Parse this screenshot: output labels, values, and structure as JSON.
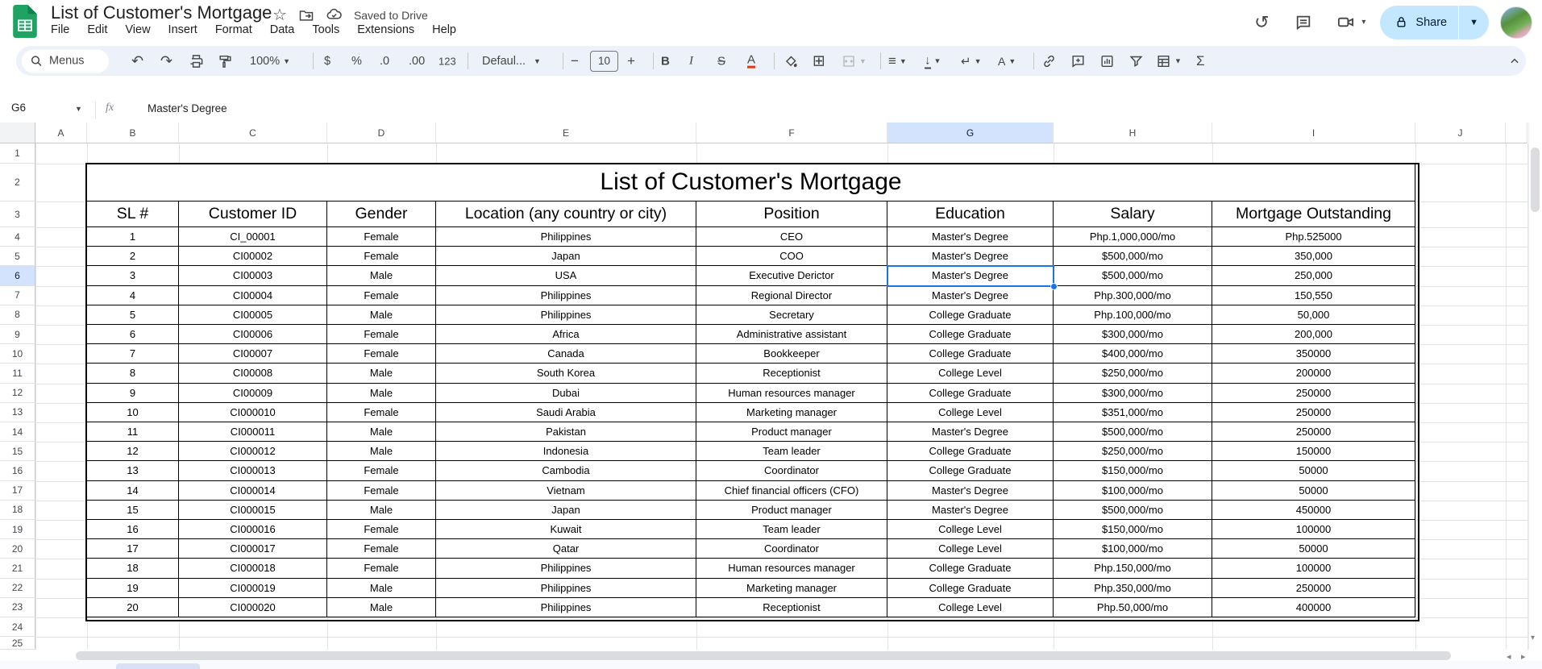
{
  "app": {
    "product": "Google Sheets",
    "title": "List of Customer's Mortgage",
    "saved_status": "Saved to Drive",
    "menus": [
      "File",
      "Edit",
      "View",
      "Insert",
      "Format",
      "Data",
      "Tools",
      "Extensions",
      "Help"
    ],
    "share_label": "Share"
  },
  "toolbar": {
    "menus_label": "Menus",
    "zoom_value": "100%",
    "currency": "$",
    "percent": "%",
    "decimal_decrease": ".0",
    "decimal_increase": ".00",
    "number_format": "123",
    "font_name": "Defaul...",
    "decrease_font": "−",
    "font_size": "10",
    "increase_font": "+",
    "bold": "B",
    "italic": "I",
    "strikethrough": "S",
    "text_color": "A",
    "text_rotation": "A",
    "sum": "Σ"
  },
  "formula_bar": {
    "cell_ref": "G6",
    "fx_label": "fx",
    "value": "Master's Degree"
  },
  "grid": {
    "columns": [
      "A",
      "B",
      "C",
      "D",
      "E",
      "F",
      "G",
      "H",
      "I",
      "J"
    ],
    "visible_rows": 25,
    "selected_cell": {
      "column": "G",
      "row": 6
    }
  },
  "sheet": {
    "table_title": "List of Customer's Mortgage",
    "headers": [
      "SL #",
      "Customer ID",
      "Gender",
      "Location (any country or city)",
      "Position",
      "Education",
      "Salary",
      "Mortgage Outstanding"
    ],
    "rows": [
      [
        "1",
        "CI_00001",
        "Female",
        "Philippines",
        "CEO",
        "Master's Degree",
        "Php.1,000,000/mo",
        "Php.525000"
      ],
      [
        "2",
        "CI00002",
        "Female",
        "Japan",
        "COO",
        "Master's Degree",
        "$500,000/mo",
        "350,000"
      ],
      [
        "3",
        "CI00003",
        "Male",
        "USA",
        "Executive Derictor",
        "Master's Degree",
        "$500,000/mo",
        "250,000"
      ],
      [
        "4",
        "CI00004",
        "Female",
        "Philippines",
        "Regional Director",
        "Master's Degree",
        "Php.300,000/mo",
        "150,550"
      ],
      [
        "5",
        "CI00005",
        "Male",
        "Philippines",
        "Secretary",
        "College Graduate",
        "Php.100,000/mo",
        "50,000"
      ],
      [
        "6",
        "CI00006",
        "Female",
        "Africa",
        "Administrative assistant",
        "College Graduate",
        "$300,000/mo",
        "200,000"
      ],
      [
        "7",
        "CI00007",
        "Female",
        "Canada",
        "Bookkeeper",
        "College Graduate",
        "$400,000/mo",
        "350000"
      ],
      [
        "8",
        "CI00008",
        "Male",
        "South Korea",
        "Receptionist",
        "College Level",
        "$250,000/mo",
        "200000"
      ],
      [
        "9",
        "CI00009",
        "Male",
        "Dubai",
        "Human resources manager",
        "College Graduate",
        "$300,000/mo",
        "250000"
      ],
      [
        "10",
        "CI000010",
        "Female",
        "Saudi Arabia",
        "Marketing manager",
        "College Level",
        "$351,000/mo",
        "250000"
      ],
      [
        "11",
        "CI000011",
        "Male",
        "Pakistan",
        "Product manager",
        "Master's Degree",
        "$500,000/mo",
        "250000"
      ],
      [
        "12",
        "CI000012",
        "Male",
        "Indonesia",
        "Team leader",
        "College Graduate",
        "$250,000/mo",
        "150000"
      ],
      [
        "13",
        "CI000013",
        "Female",
        "Cambodia",
        "Coordinator",
        "College Graduate",
        "$150,000/mo",
        "50000"
      ],
      [
        "14",
        "CI000014",
        "Female",
        "Vietnam",
        "Chief financial officers (CFO)",
        "Master's Degree",
        "$100,000/mo",
        "50000"
      ],
      [
        "15",
        "CI000015",
        "Male",
        "Japan",
        "Product manager",
        "Master's Degree",
        "$500,000/mo",
        "450000"
      ],
      [
        "16",
        "CI000016",
        "Female",
        "Kuwait",
        "Team leader",
        "College Level",
        "$150,000/mo",
        "100000"
      ],
      [
        "17",
        "CI000017",
        "Female",
        "Qatar",
        "Coordinator",
        "College Level",
        "$100,000/mo",
        "50000"
      ],
      [
        "18",
        "CI000018",
        "Female",
        "Philippines",
        "Human resources manager",
        "College Graduate",
        "Php.150,000/mo",
        "100000"
      ],
      [
        "19",
        "CI000019",
        "Male",
        "Philippines",
        "Marketing manager",
        "College Graduate",
        "Php.350,000/mo",
        "250000"
      ],
      [
        "20",
        "CI000020",
        "Male",
        "Philippines",
        "Receptionist",
        "College Level",
        "Php.50,000/mo",
        "400000"
      ]
    ]
  },
  "colors": {
    "accent": "#1a73e8",
    "selection_header_bg": "#d3e3fd",
    "share_button_bg": "#c2e7ff",
    "toolbar_bg": "#edf2fa",
    "logo_green": "#1ea362"
  }
}
